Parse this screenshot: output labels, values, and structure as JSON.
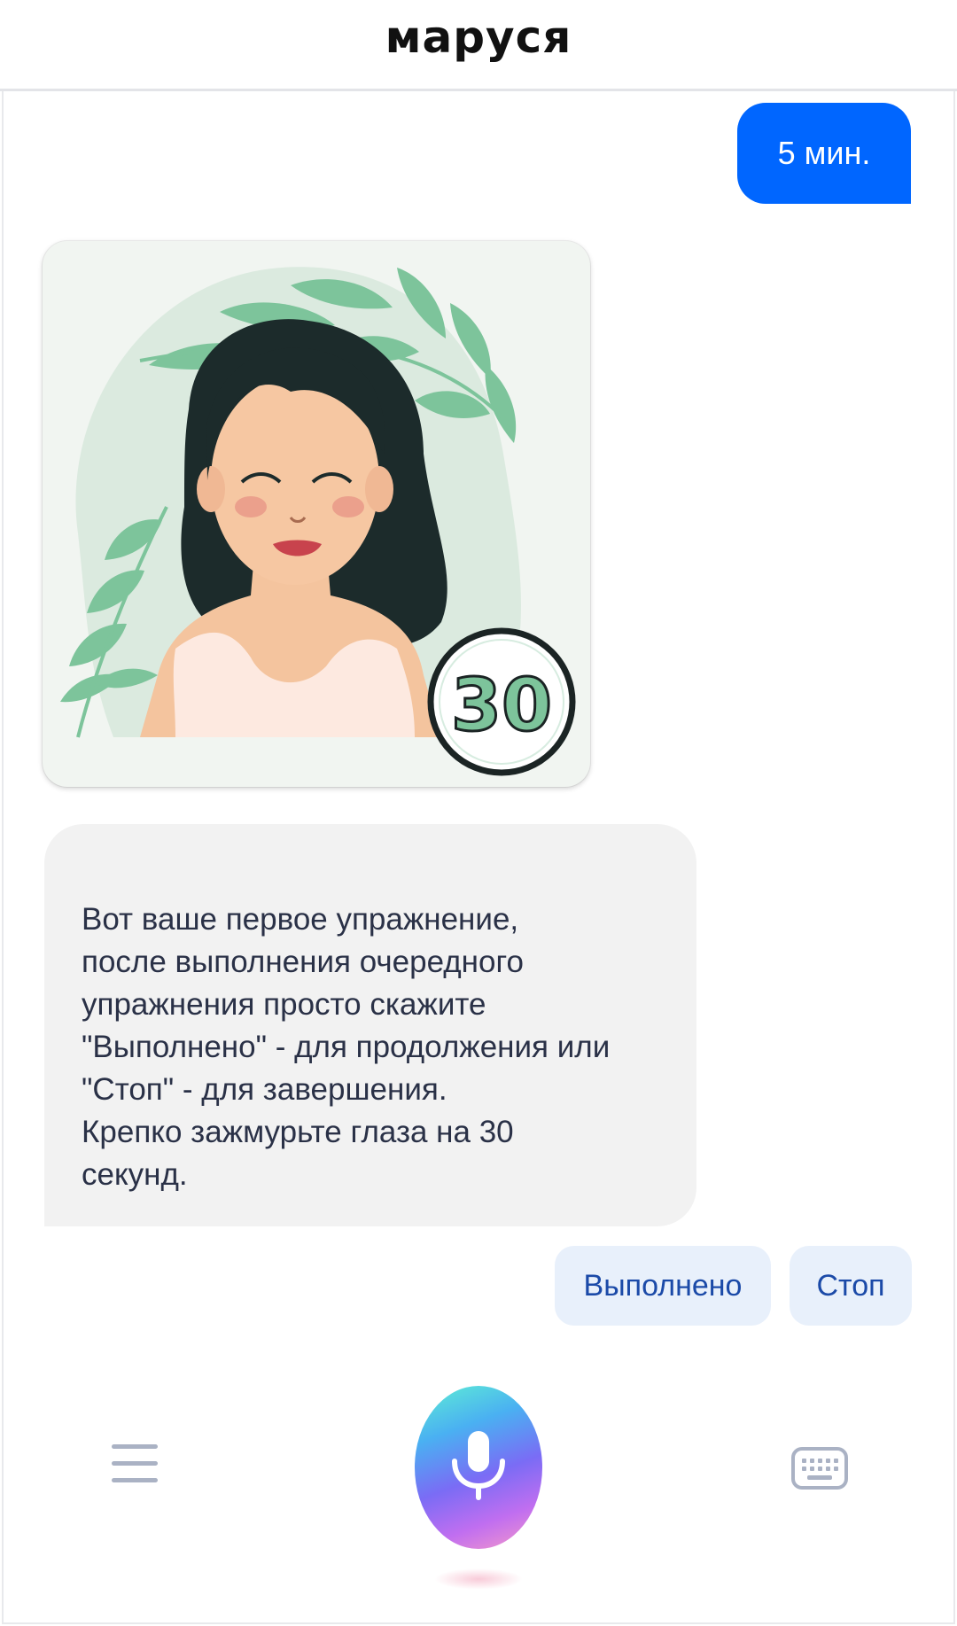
{
  "header": {
    "title": "маруся"
  },
  "messages": {
    "user_message": "5 мин.",
    "bot_image_badge": "30",
    "bot_text": "Вот ваше первое упражнение,\nпосле выполнения очередного\nупражнения просто скажите\n\"Выполнено\" - для продолжения или\n\"Стоп\" - для завершения.\nКрепко зажмурьте глаза на 30\nсекунд."
  },
  "suggestions": {
    "done_label": "Выполнено",
    "stop_label": "Стоп"
  },
  "bottom_bar": {
    "menu_icon": "hamburger-menu-icon",
    "mic_icon": "microphone-icon",
    "keyboard_icon": "keyboard-icon"
  },
  "colors": {
    "user_bubble": "#0066ff",
    "bot_bubble": "#f2f2f2",
    "chip_bg": "#e8f0fb",
    "chip_text": "#1b4aa8",
    "icon_gray": "#aab2c4"
  }
}
